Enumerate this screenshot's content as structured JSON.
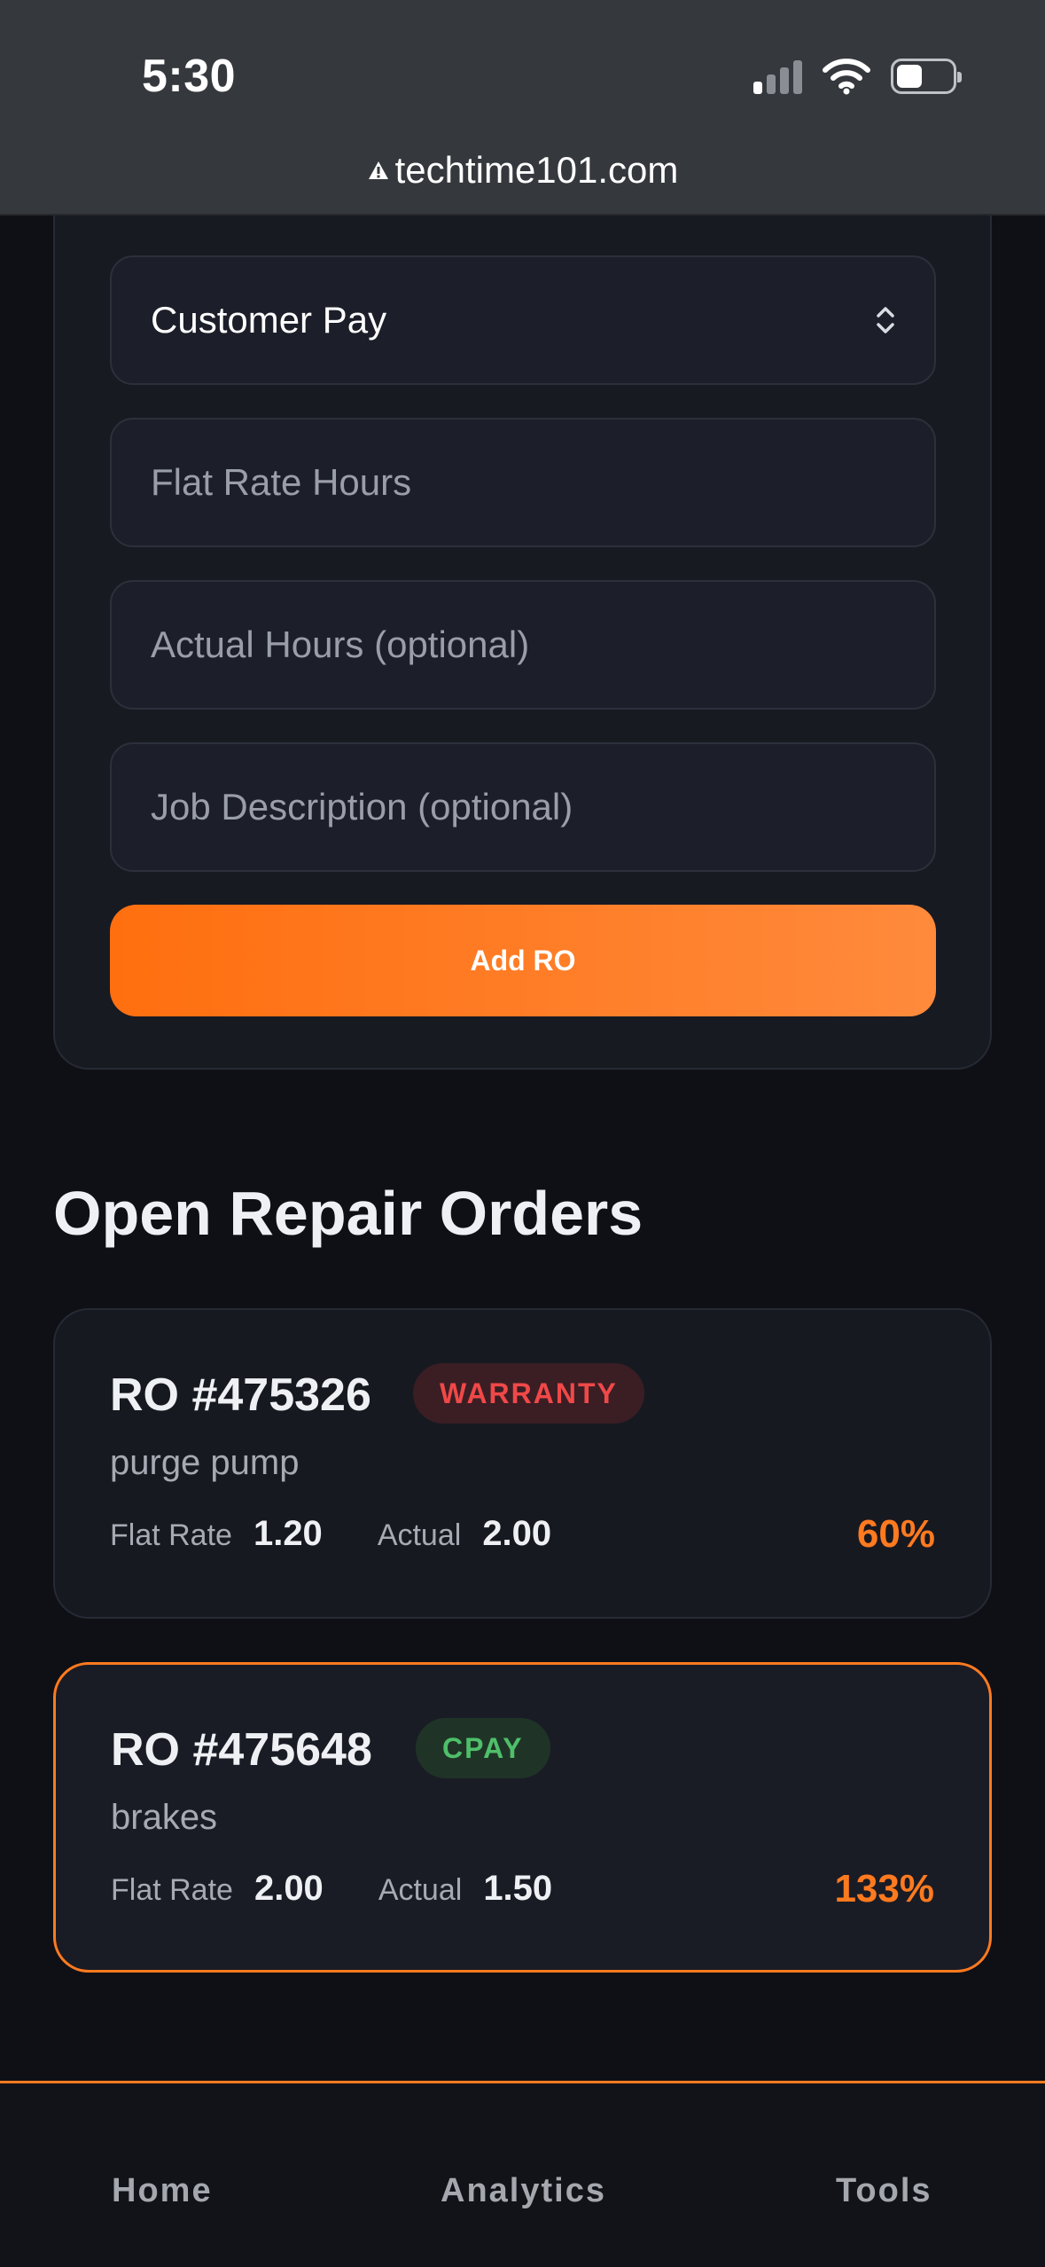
{
  "status_bar": {
    "time": "5:30"
  },
  "browser": {
    "url": "techtime101.com"
  },
  "form": {
    "pay_type": "Customer Pay",
    "flat_rate_placeholder": "Flat Rate Hours",
    "actual_hours_placeholder": "Actual Hours (optional)",
    "job_description_placeholder": "Job Description (optional)",
    "add_button_label": "Add RO"
  },
  "section_title": "Open Repair Orders",
  "repair_orders": [
    {
      "number": "RO #475326",
      "type": "WARRANTY",
      "description": "purge pump",
      "flat_rate_label": "Flat Rate",
      "flat_rate": "1.20",
      "actual_label": "Actual",
      "actual": "2.00",
      "efficiency": "60%"
    },
    {
      "number": "RO #475648",
      "type": "CPAY",
      "description": "brakes",
      "flat_rate_label": "Flat Rate",
      "flat_rate": "2.00",
      "actual_label": "Actual",
      "actual": "1.50",
      "efficiency": "133%"
    }
  ],
  "bottom_nav": {
    "home": "Home",
    "analytics": "Analytics",
    "tools": "Tools"
  },
  "colors": {
    "accent": "#ff7a1f",
    "warranty": "#f04848",
    "cpay": "#4fbf6a"
  },
  "icons": {
    "select": "chevron-up-down-icon",
    "url_lock": "warning-icon"
  }
}
